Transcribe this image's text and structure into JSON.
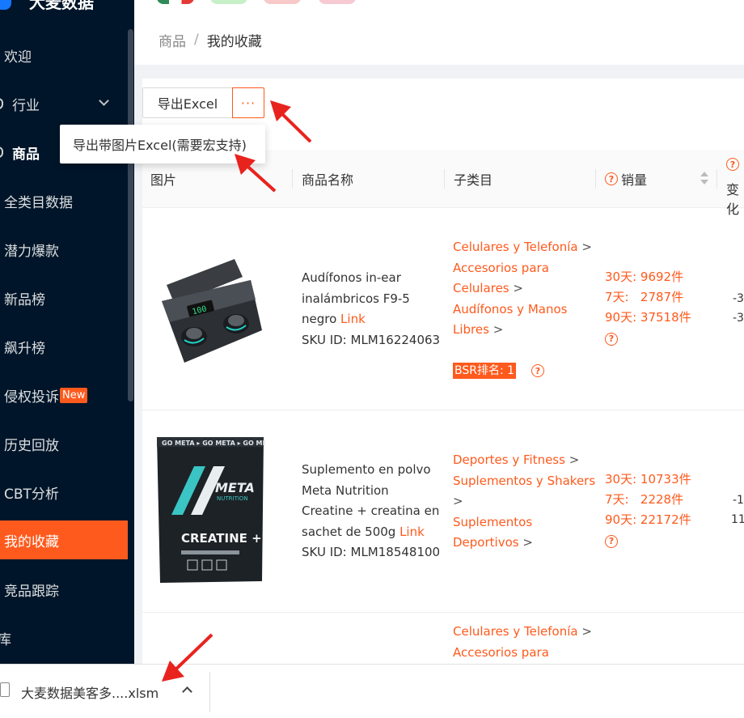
{
  "app": {
    "logo_text": "大麦数据"
  },
  "sidebar": {
    "items": [
      {
        "label": "欢迎"
      },
      {
        "label": "行业"
      },
      {
        "label": "商品"
      },
      {
        "label": "全类目数据"
      },
      {
        "label": "潜力爆款"
      },
      {
        "label": "新品榜"
      },
      {
        "label": "飙升榜"
      },
      {
        "label": "侵权投诉",
        "badge": "New"
      },
      {
        "label": "历史回放"
      },
      {
        "label": "CBT分析"
      },
      {
        "label": "我的收藏"
      },
      {
        "label": "竞品跟踪"
      },
      {
        "label": "库"
      }
    ]
  },
  "breadcrumb": {
    "root": "商品",
    "separator": "/",
    "current": "我的收藏"
  },
  "toolbar": {
    "export_label": "导出Excel",
    "more_label": "···",
    "dropdown_item": "导出带图片Excel(需要宏支持)"
  },
  "table": {
    "headers": {
      "image": "图片",
      "name": "商品名称",
      "subcategory": "子类目",
      "sales": "销量",
      "change_partial": "变化"
    },
    "rows": [
      {
        "name_lines": [
          "Audífonos in-ear",
          "inalámbricos F9-5",
          "negro "
        ],
        "link": "Link",
        "sku": "SKU ID: MLM16224063",
        "categories": [
          "Celulares y Telefonía",
          "Accesorios para",
          "Celulares",
          "Audífonos y Manos",
          "Libres"
        ],
        "sales_30": "30天: 9692件",
        "sales_7": "7天:   2787件",
        "sales_90": "90天: 37518件",
        "bsr": "BSR排名: 1",
        "edge_values": [
          "-3",
          "-3"
        ]
      },
      {
        "name_lines": [
          "Suplemento en polvo",
          "Meta Nutrition",
          "Creatine + creatina en",
          "sachet de 500g "
        ],
        "link": "Link",
        "sku": "SKU ID: MLM18548100",
        "categories": [
          "Deportes y Fitness",
          "Suplementos y Shakers",
          "",
          "Suplementos",
          "Deportivos"
        ],
        "sales_30": "30天: 10733件",
        "sales_7": "7天:   2228件",
        "sales_90": "90天: 22172件",
        "edge_values": [
          "-1",
          "11"
        ]
      },
      {
        "categories": [
          "Celulares y Telefonía",
          "Accesorios para"
        ]
      }
    ]
  },
  "download": {
    "filename": "大麦数据美客多....xlsm"
  },
  "colors": {
    "accent": "#fe5a1d",
    "sidebar_bg": "#001529"
  }
}
